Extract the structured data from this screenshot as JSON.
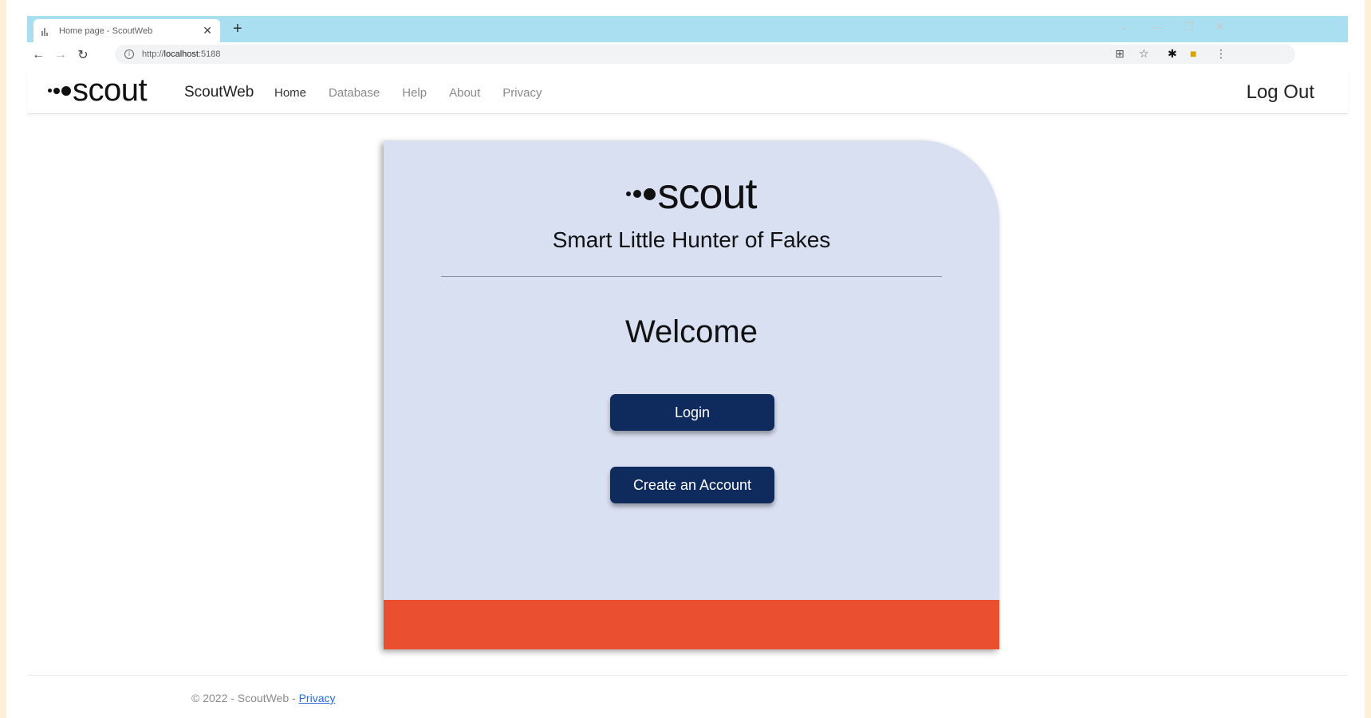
{
  "browser": {
    "tab_title": "Home page - ScoutWeb",
    "tab_close": "✕",
    "new_tab": "+",
    "url_scheme": "http://",
    "url_host": "localhost",
    "url_port": ":5188",
    "icons": [
      "back-arrow-icon",
      "forward-arrow-icon",
      "reload-icon",
      "site-info-icon",
      "translate-icon",
      "bookmark-star-icon",
      "extensions-icon",
      "profile-icon",
      "menu-icon"
    ]
  },
  "nav": {
    "brand": "scout",
    "site_name": "ScoutWeb",
    "links": [
      "Home",
      "Database",
      "Help",
      "About",
      "Privacy"
    ],
    "logout": "Log Out"
  },
  "card": {
    "logo": "scout",
    "tagline": "Smart Little Hunter of Fakes",
    "welcome": "Welcome",
    "login_label": "Login",
    "create_label": "Create an Account"
  },
  "footer": {
    "copyright": "© 2022 - ScoutWeb - ",
    "privacy_link": "Privacy"
  },
  "colors": {
    "tabstrip": "#a9dff0",
    "card_bg": "#d9e0f2",
    "button": "#0f2a5c",
    "band": "#ea5030",
    "page_border": "#fdf0d6"
  }
}
